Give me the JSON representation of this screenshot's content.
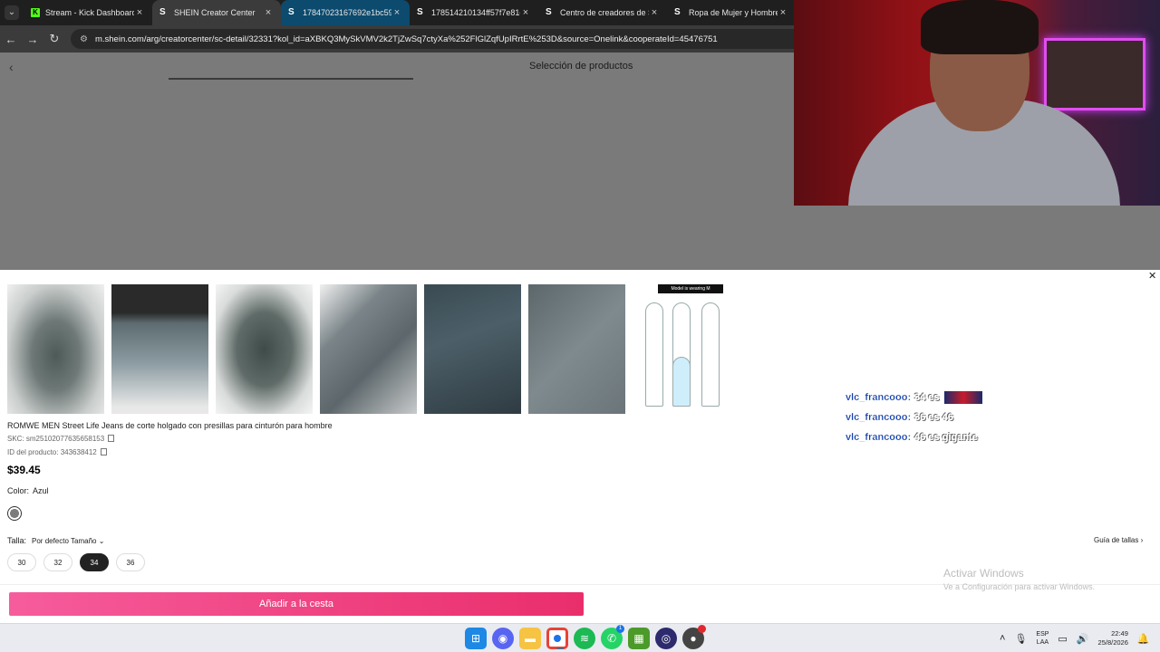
{
  "browser": {
    "tabs": [
      {
        "title": "Stream - Kick Dashboard",
        "icon": "kick-icon"
      },
      {
        "title": "SHEIN Creator Center",
        "icon": "shein-icon"
      },
      {
        "title": "17847023167692e1bc599",
        "icon": "shein-icon"
      },
      {
        "title": "178514210134ff57f7e81c2",
        "icon": "shein-icon"
      },
      {
        "title": "Centro de creadores de SH",
        "icon": "shein-icon"
      },
      {
        "title": "Ropa de Mujer y Hombre,",
        "icon": "shein-icon"
      }
    ],
    "url": "m.shein.com/arg/creatorcenter/sc-detail/32331?kol_id=aXBKQ3MySkVMV2k2TjZwSq7ctyXa%252FlGlZqfUpIRrtE%253D&source=Onelink&cooperateId=45476751"
  },
  "page": {
    "title": "Selección de productos"
  },
  "product": {
    "name": "ROMWE MEN Street Life Jeans de corte holgado con presillas para cinturón para hombre",
    "skc": "SKC: sm25102077635658153",
    "product_id": "ID del producto: 343638412",
    "price": "$39.45",
    "color_label": "Color:",
    "color_value": "Azul",
    "size_label": "Talla:",
    "size_sort": "Por defecto Tamaño",
    "size_guide": "Guía de tallas",
    "sizes": [
      "30",
      "32",
      "34",
      "36"
    ],
    "selected_size": "34",
    "add_to_cart": "Añadir a la cesta",
    "size_chart_banner": "Model is wearing M"
  },
  "chat": [
    {
      "user": "vlc_francooo:",
      "message": "34 es"
    },
    {
      "user": "vlc_francooo:",
      "message": "36 es 46"
    },
    {
      "user": "vlc_francooo:",
      "message": "46 es gigante"
    }
  ],
  "windows": {
    "activate_title": "Activar Windows",
    "activate_sub": "Ve a Configuración para activar Windows.",
    "lang_line1": "ESP",
    "lang_line2": "LAA",
    "time": "22:49",
    "date": "25/8/2026"
  },
  "colors": {
    "accent_pink": "#ea2e6c",
    "chat_user": "#0f3ea8"
  }
}
